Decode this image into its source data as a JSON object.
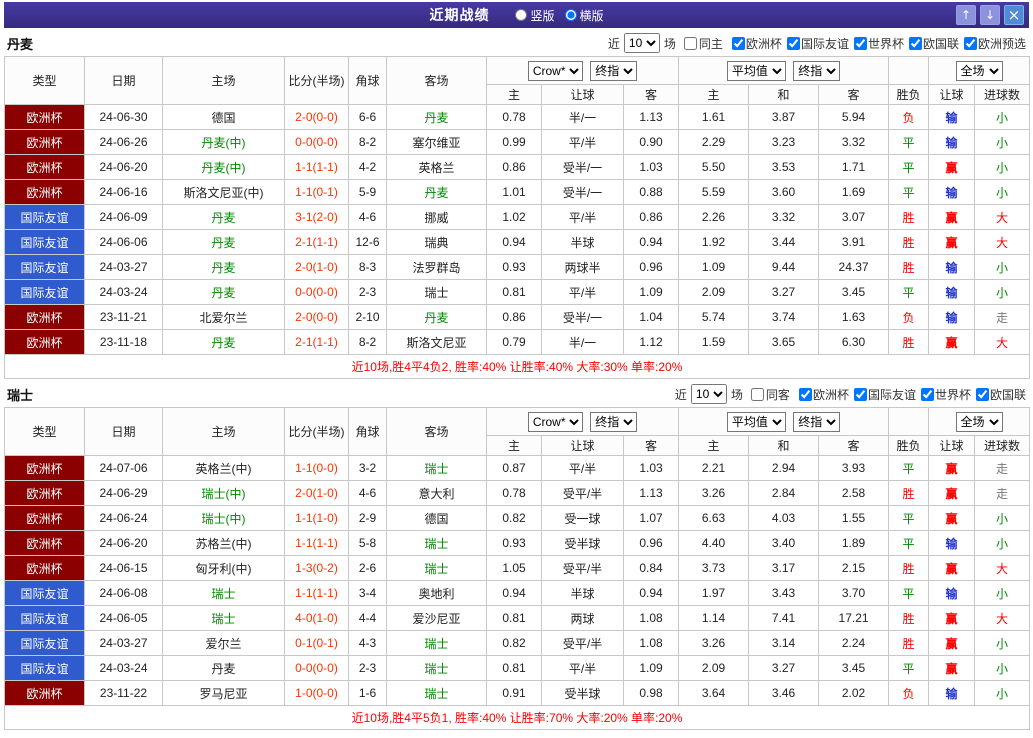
{
  "titlebar": {
    "title": "近期战绩",
    "modes": [
      {
        "label": "竖版",
        "selected": false
      },
      {
        "label": "横版",
        "selected": true
      }
    ],
    "buttons": {
      "up": "↑",
      "down": "↓",
      "close": "×"
    }
  },
  "labels": {
    "near": "近",
    "games": "场"
  },
  "controls": {
    "bookmaker": "Crow*",
    "final": "终指",
    "average": "平均值",
    "scope": "全场"
  },
  "header": {
    "type": "类型",
    "date": "日期",
    "home": "主场",
    "score": "比分(半场)",
    "corners": "角球",
    "away": "客场",
    "odds_home": "主",
    "odds_handicap": "让球",
    "odds_away": "客",
    "avg_home": "主",
    "avg_draw": "和",
    "avg_away": "客",
    "result": "胜负",
    "handicap_result": "让球",
    "goals": "进球数"
  },
  "colors": {
    "titlebar_bg": "#3b2e8c",
    "type_bg": {
      "欧洲杯": "#8b0000",
      "国际友谊": "#2f5bce"
    },
    "focus_team": "#008800",
    "score": "#ff3300",
    "result": {
      "胜": "#ff0000",
      "平": "#008800",
      "负": "#ff0000"
    },
    "handicap_result": {
      "赢": "#ff0000",
      "输": "#2233cc",
      "走": "#777777"
    },
    "goals": {
      "大": "#ff0000",
      "小": "#008800",
      "走": "#777777"
    },
    "summary": "#ff0000"
  },
  "sections": [
    {
      "team": "丹麦",
      "filter": {
        "count": "10",
        "same": {
          "label": "同主",
          "checked": false
        },
        "comps": [
          {
            "label": "欧洲杯",
            "checked": true
          },
          {
            "label": "国际友谊",
            "checked": true
          },
          {
            "label": "世界杯",
            "checked": true
          },
          {
            "label": "欧国联",
            "checked": true
          },
          {
            "label": "欧洲预选",
            "checked": true
          }
        ]
      },
      "rows": [
        {
          "type": "欧洲杯",
          "date": "24-06-30",
          "home": "德国",
          "score": "2-0(0-0)",
          "corners": "6-6",
          "away": "丹麦",
          "away_focus": true,
          "odds": [
            "0.78",
            "半/一",
            "1.13"
          ],
          "avg": [
            "1.61",
            "3.87",
            "5.94"
          ],
          "result": "负",
          "h_result": "输",
          "goals": "小"
        },
        {
          "type": "欧洲杯",
          "date": "24-06-26",
          "home": "丹麦(中)",
          "home_focus": true,
          "score": "0-0(0-0)",
          "corners": "8-2",
          "away": "塞尔维亚",
          "odds": [
            "0.99",
            "平/半",
            "0.90"
          ],
          "avg": [
            "2.29",
            "3.23",
            "3.32"
          ],
          "result": "平",
          "h_result": "输",
          "goals": "小"
        },
        {
          "type": "欧洲杯",
          "date": "24-06-20",
          "home": "丹麦(中)",
          "home_focus": true,
          "score": "1-1(1-1)",
          "corners": "4-2",
          "away": "英格兰",
          "odds": [
            "0.86",
            "受半/一",
            "1.03"
          ],
          "avg": [
            "5.50",
            "3.53",
            "1.71"
          ],
          "result": "平",
          "h_result": "赢",
          "goals": "小"
        },
        {
          "type": "欧洲杯",
          "date": "24-06-16",
          "home": "斯洛文尼亚(中)",
          "score": "1-1(0-1)",
          "corners": "5-9",
          "away": "丹麦",
          "away_focus": true,
          "odds": [
            "1.01",
            "受半/一",
            "0.88"
          ],
          "avg": [
            "5.59",
            "3.60",
            "1.69"
          ],
          "result": "平",
          "h_result": "输",
          "goals": "小"
        },
        {
          "type": "国际友谊",
          "date": "24-06-09",
          "home": "丹麦",
          "home_focus": true,
          "score": "3-1(2-0)",
          "corners": "4-6",
          "away": "挪威",
          "odds": [
            "1.02",
            "平/半",
            "0.86"
          ],
          "avg": [
            "2.26",
            "3.32",
            "3.07"
          ],
          "result": "胜",
          "h_result": "赢",
          "goals": "大"
        },
        {
          "type": "国际友谊",
          "date": "24-06-06",
          "home": "丹麦",
          "home_focus": true,
          "score": "2-1(1-1)",
          "corners": "12-6",
          "away": "瑞典",
          "odds": [
            "0.94",
            "半球",
            "0.94"
          ],
          "avg": [
            "1.92",
            "3.44",
            "3.91"
          ],
          "result": "胜",
          "h_result": "赢",
          "goals": "大"
        },
        {
          "type": "国际友谊",
          "date": "24-03-27",
          "home": "丹麦",
          "home_focus": true,
          "score": "2-0(1-0)",
          "corners": "8-3",
          "away": "法罗群岛",
          "odds": [
            "0.93",
            "两球半",
            "0.96"
          ],
          "avg": [
            "1.09",
            "9.44",
            "24.37"
          ],
          "result": "胜",
          "h_result": "输",
          "goals": "小"
        },
        {
          "type": "国际友谊",
          "date": "24-03-24",
          "home": "丹麦",
          "home_focus": true,
          "score": "0-0(0-0)",
          "corners": "2-3",
          "away": "瑞士",
          "odds": [
            "0.81",
            "平/半",
            "1.09"
          ],
          "avg": [
            "2.09",
            "3.27",
            "3.45"
          ],
          "result": "平",
          "h_result": "输",
          "goals": "小"
        },
        {
          "type": "欧洲杯",
          "date": "23-11-21",
          "home": "北爱尔兰",
          "score": "2-0(0-0)",
          "corners": "2-10",
          "away": "丹麦",
          "away_focus": true,
          "odds": [
            "0.86",
            "受半/一",
            "1.04"
          ],
          "avg": [
            "5.74",
            "3.74",
            "1.63"
          ],
          "result": "负",
          "h_result": "输",
          "goals": "走"
        },
        {
          "type": "欧洲杯",
          "date": "23-11-18",
          "home": "丹麦",
          "home_focus": true,
          "score": "2-1(1-1)",
          "corners": "8-2",
          "away": "斯洛文尼亚",
          "odds": [
            "0.79",
            "半/一",
            "1.12"
          ],
          "avg": [
            "1.59",
            "3.65",
            "6.30"
          ],
          "result": "胜",
          "h_result": "赢",
          "goals": "大"
        }
      ],
      "summary": "近10场,胜4平4负2, 胜率:40% 让胜率:40% 大率:30% 单率:20%"
    },
    {
      "team": "瑞士",
      "filter": {
        "count": "10",
        "same": {
          "label": "同客",
          "checked": false
        },
        "comps": [
          {
            "label": "欧洲杯",
            "checked": true
          },
          {
            "label": "国际友谊",
            "checked": true
          },
          {
            "label": "世界杯",
            "checked": true
          },
          {
            "label": "欧国联",
            "checked": true
          }
        ]
      },
      "rows": [
        {
          "type": "欧洲杯",
          "date": "24-07-06",
          "home": "英格兰(中)",
          "score": "1-1(0-0)",
          "corners": "3-2",
          "away": "瑞士",
          "away_focus": true,
          "odds": [
            "0.87",
            "平/半",
            "1.03"
          ],
          "avg": [
            "2.21",
            "2.94",
            "3.93"
          ],
          "result": "平",
          "h_result": "赢",
          "goals": "走"
        },
        {
          "type": "欧洲杯",
          "date": "24-06-29",
          "home": "瑞士(中)",
          "home_focus": true,
          "score": "2-0(1-0)",
          "corners": "4-6",
          "away": "意大利",
          "odds": [
            "0.78",
            "受平/半",
            "1.13"
          ],
          "avg": [
            "3.26",
            "2.84",
            "2.58"
          ],
          "result": "胜",
          "h_result": "赢",
          "goals": "走"
        },
        {
          "type": "欧洲杯",
          "date": "24-06-24",
          "home": "瑞士(中)",
          "home_focus": true,
          "score": "1-1(1-0)",
          "corners": "2-9",
          "away": "德国",
          "odds": [
            "0.82",
            "受一球",
            "1.07"
          ],
          "avg": [
            "6.63",
            "4.03",
            "1.55"
          ],
          "result": "平",
          "h_result": "赢",
          "goals": "小"
        },
        {
          "type": "欧洲杯",
          "date": "24-06-20",
          "home": "苏格兰(中)",
          "score": "1-1(1-1)",
          "corners": "5-8",
          "away": "瑞士",
          "away_focus": true,
          "odds": [
            "0.93",
            "受半球",
            "0.96"
          ],
          "avg": [
            "4.40",
            "3.40",
            "1.89"
          ],
          "result": "平",
          "h_result": "输",
          "goals": "小"
        },
        {
          "type": "欧洲杯",
          "date": "24-06-15",
          "home": "匈牙利(中)",
          "score": "1-3(0-2)",
          "corners": "2-6",
          "away": "瑞士",
          "away_focus": true,
          "odds": [
            "1.05",
            "受平/半",
            "0.84"
          ],
          "avg": [
            "3.73",
            "3.17",
            "2.15"
          ],
          "result": "胜",
          "h_result": "赢",
          "goals": "大"
        },
        {
          "type": "国际友谊",
          "date": "24-06-08",
          "home": "瑞士",
          "home_focus": true,
          "score": "1-1(1-1)",
          "corners": "3-4",
          "away": "奥地利",
          "odds": [
            "0.94",
            "半球",
            "0.94"
          ],
          "avg": [
            "1.97",
            "3.43",
            "3.70"
          ],
          "result": "平",
          "h_result": "输",
          "goals": "小"
        },
        {
          "type": "国际友谊",
          "date": "24-06-05",
          "home": "瑞士",
          "home_focus": true,
          "score": "4-0(1-0)",
          "corners": "4-4",
          "away": "爱沙尼亚",
          "odds": [
            "0.81",
            "两球",
            "1.08"
          ],
          "avg": [
            "1.14",
            "7.41",
            "17.21"
          ],
          "result": "胜",
          "h_result": "赢",
          "goals": "大"
        },
        {
          "type": "国际友谊",
          "date": "24-03-27",
          "home": "爱尔兰",
          "score": "0-1(0-1)",
          "corners": "4-3",
          "away": "瑞士",
          "away_focus": true,
          "odds": [
            "0.82",
            "受平/半",
            "1.08"
          ],
          "avg": [
            "3.26",
            "3.14",
            "2.24"
          ],
          "result": "胜",
          "h_result": "赢",
          "goals": "小"
        },
        {
          "type": "国际友谊",
          "date": "24-03-24",
          "home": "丹麦",
          "score": "0-0(0-0)",
          "corners": "2-3",
          "away": "瑞士",
          "away_focus": true,
          "odds": [
            "0.81",
            "平/半",
            "1.09"
          ],
          "avg": [
            "2.09",
            "3.27",
            "3.45"
          ],
          "result": "平",
          "h_result": "赢",
          "goals": "小"
        },
        {
          "type": "欧洲杯",
          "date": "23-11-22",
          "home": "罗马尼亚",
          "score": "1-0(0-0)",
          "corners": "1-6",
          "away": "瑞士",
          "away_focus": true,
          "odds": [
            "0.91",
            "受半球",
            "0.98"
          ],
          "avg": [
            "3.64",
            "3.46",
            "2.02"
          ],
          "result": "负",
          "h_result": "输",
          "goals": "小"
        }
      ],
      "summary": "近10场,胜4平5负1, 胜率:40% 让胜率:70% 大率:20% 单率:20%"
    }
  ]
}
